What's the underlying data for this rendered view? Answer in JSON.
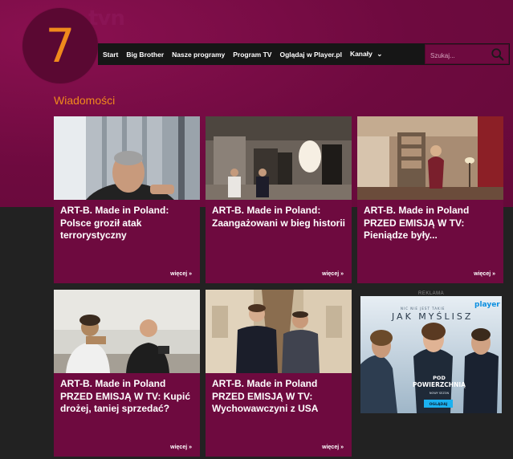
{
  "header": {
    "logo_number": "7",
    "logo_text": "tvn"
  },
  "nav": {
    "items": [
      "Start",
      "Big Brother",
      "Nasze programy",
      "Program TV",
      "Oglądaj w Player.pl",
      "Kanały"
    ],
    "dropdown_caret": "⌄"
  },
  "search": {
    "placeholder": "Szukaj..."
  },
  "section": {
    "title": "Wiadomości"
  },
  "cards": [
    {
      "title": "ART-B. Made in Poland: Polsce groził atak terrorystyczny",
      "more": "więcej »"
    },
    {
      "title": "ART-B. Made in Poland: Zaangażowani w bieg historii",
      "more": "więcej »"
    },
    {
      "title": "ART-B. Made in Poland PRZED EMISJĄ W TV: Pieniądze były...",
      "more": "więcej »"
    },
    {
      "title": "ART-B. Made in Poland PRZED EMISJĄ W TV: Kupić drożej, taniej sprzedać?",
      "more": "więcej »"
    },
    {
      "title": "ART-B. Made in Poland PRZED EMISJĄ W TV: Wychowawczyni z USA",
      "more": "więcej »"
    }
  ],
  "ad": {
    "label": "REKLAMA",
    "tagline": "NIC NIE JEST TAKIE",
    "headline": "JAK MYŚLISZ",
    "brand": "player",
    "show_title_1": "POD",
    "show_title_2": "POWIERZCHNIĄ",
    "show_subtitle": "NOWY SEZON",
    "cta": "OGLĄDAJ"
  },
  "colors": {
    "brand_magenta": "#6e0a3f",
    "accent_orange": "#f08a1c",
    "nav_bg": "#161616",
    "page_bg": "#222222"
  }
}
